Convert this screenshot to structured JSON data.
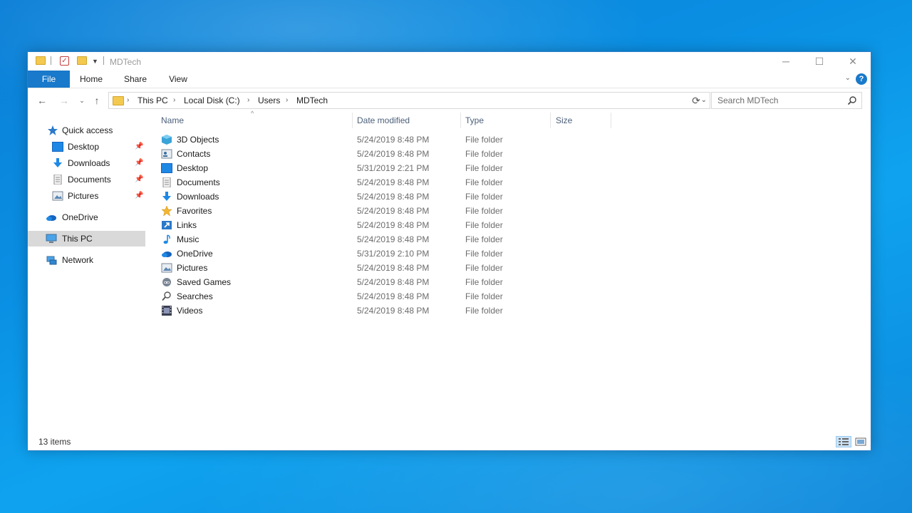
{
  "window": {
    "title": "MDTech"
  },
  "ribbon": {
    "tabs": [
      {
        "label": "File"
      },
      {
        "label": "Home"
      },
      {
        "label": "Share"
      },
      {
        "label": "View"
      }
    ]
  },
  "address": {
    "crumbs": [
      "This PC",
      "Local Disk (C:)",
      "Users",
      "MDTech"
    ]
  },
  "search": {
    "placeholder": "Search MDTech"
  },
  "sidebar": {
    "quick_access": "Quick access",
    "pinned": [
      {
        "label": "Desktop",
        "icon": "desktop-icon"
      },
      {
        "label": "Downloads",
        "icon": "downloads-icon"
      },
      {
        "label": "Documents",
        "icon": "documents-icon"
      },
      {
        "label": "Pictures",
        "icon": "pictures-icon"
      }
    ],
    "onedrive": "OneDrive",
    "this_pc": "This PC",
    "network": "Network"
  },
  "columns": {
    "name": "Name",
    "date": "Date modified",
    "type": "Type",
    "size": "Size"
  },
  "files": [
    {
      "name": "3D Objects",
      "date": "5/24/2019 8:48 PM",
      "type": "File folder",
      "icon": "3d-objects-icon"
    },
    {
      "name": "Contacts",
      "date": "5/24/2019 8:48 PM",
      "type": "File folder",
      "icon": "contacts-icon"
    },
    {
      "name": "Desktop",
      "date": "5/31/2019 2:21 PM",
      "type": "File folder",
      "icon": "desktop-icon"
    },
    {
      "name": "Documents",
      "date": "5/24/2019 8:48 PM",
      "type": "File folder",
      "icon": "documents-icon"
    },
    {
      "name": "Downloads",
      "date": "5/24/2019 8:48 PM",
      "type": "File folder",
      "icon": "downloads-icon"
    },
    {
      "name": "Favorites",
      "date": "5/24/2019 8:48 PM",
      "type": "File folder",
      "icon": "favorites-icon"
    },
    {
      "name": "Links",
      "date": "5/24/2019 8:48 PM",
      "type": "File folder",
      "icon": "links-icon"
    },
    {
      "name": "Music",
      "date": "5/24/2019 8:48 PM",
      "type": "File folder",
      "icon": "music-icon"
    },
    {
      "name": "OneDrive",
      "date": "5/31/2019 2:10 PM",
      "type": "File folder",
      "icon": "onedrive-icon"
    },
    {
      "name": "Pictures",
      "date": "5/24/2019 8:48 PM",
      "type": "File folder",
      "icon": "pictures-icon"
    },
    {
      "name": "Saved Games",
      "date": "5/24/2019 8:48 PM",
      "type": "File folder",
      "icon": "saved-games-icon"
    },
    {
      "name": "Searches",
      "date": "5/24/2019 8:48 PM",
      "type": "File folder",
      "icon": "searches-icon"
    },
    {
      "name": "Videos",
      "date": "5/24/2019 8:48 PM",
      "type": "File folder",
      "icon": "videos-icon"
    }
  ],
  "status": {
    "items": "13 items"
  },
  "colors": {
    "accent": "#1979ca",
    "desktop": "#0a8fe3",
    "folder": "#f3c94f"
  }
}
